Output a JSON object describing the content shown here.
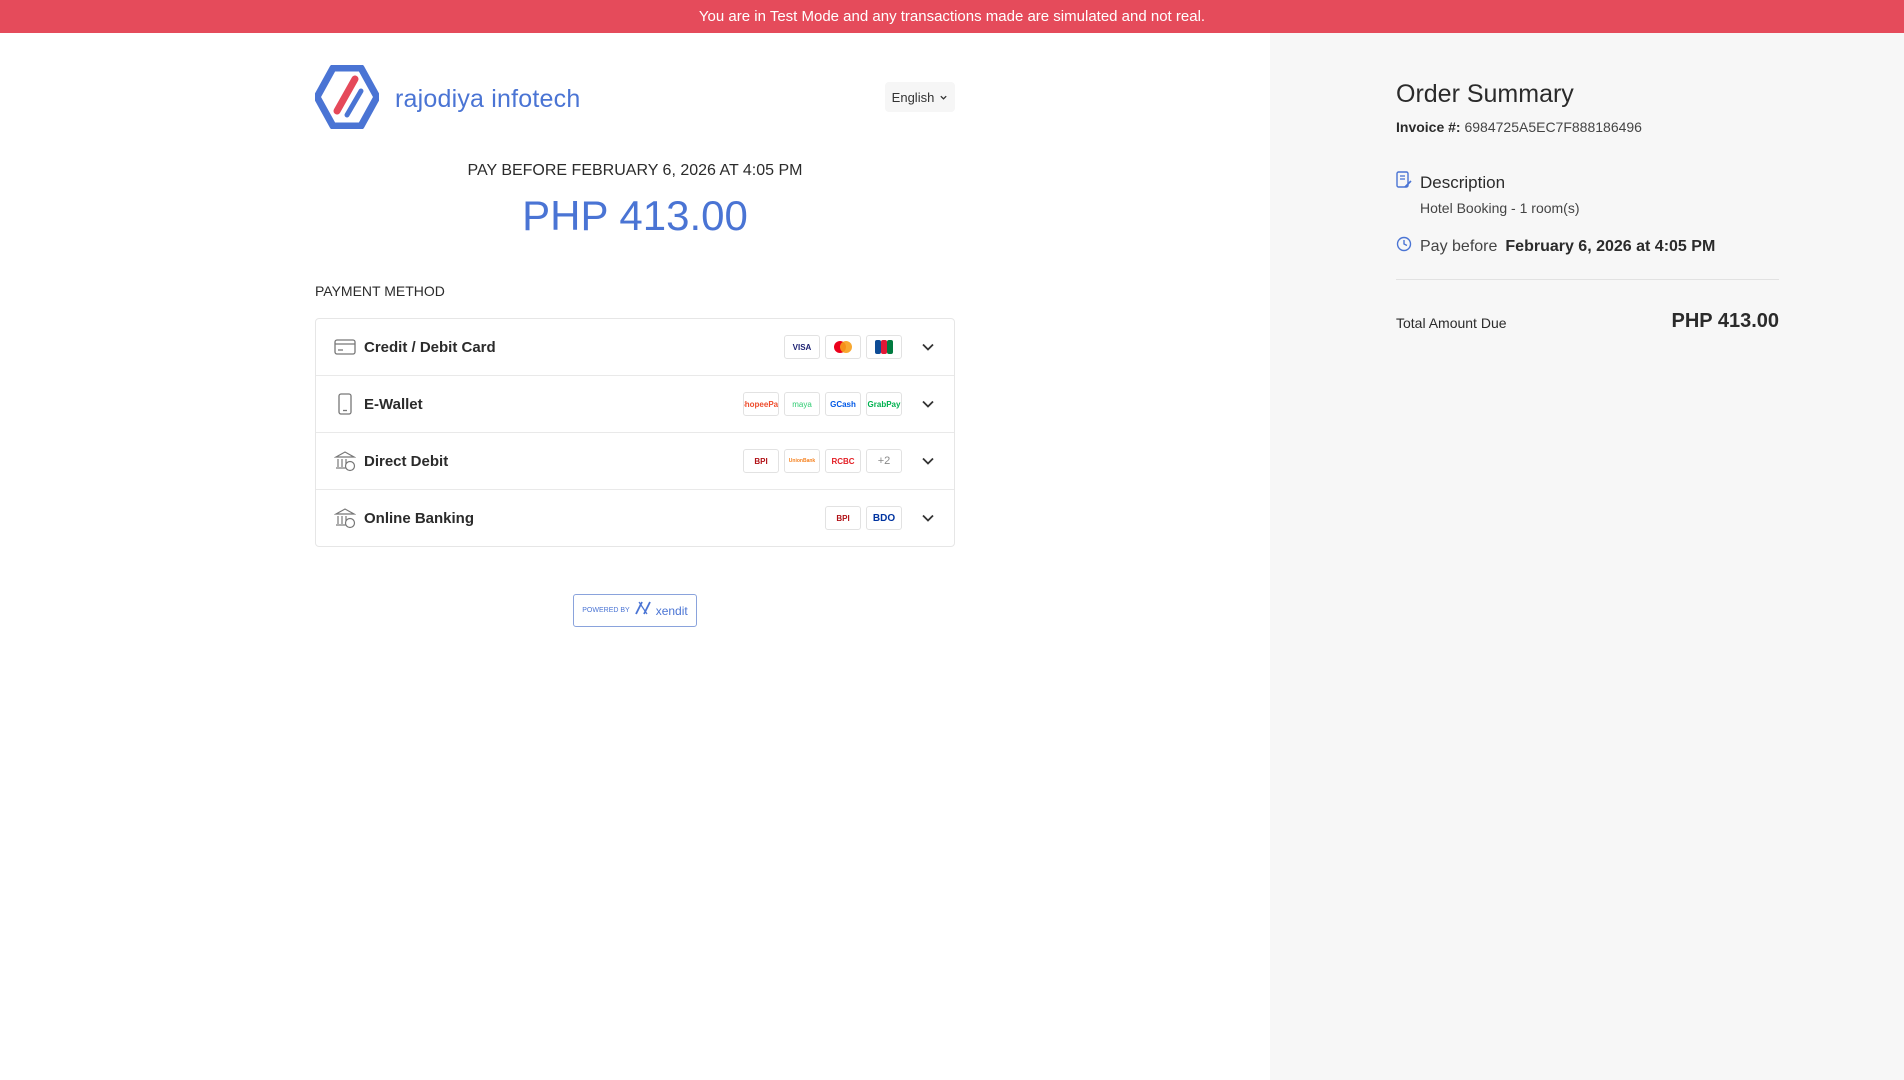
{
  "banner": {
    "text": "You are in Test Mode and any transactions made are simulated and not real."
  },
  "merchant": {
    "name": "rajodiya infotech",
    "logo_icon": "rajodiya-logo-icon"
  },
  "language": {
    "selected": "English"
  },
  "payment": {
    "pay_before": "PAY BEFORE FEBRUARY 6, 2026 AT 4:05 PM",
    "amount": "PHP 413.00",
    "method_title": "PAYMENT METHOD",
    "methods": [
      {
        "label": "Credit / Debit Card",
        "icon": "credit-card-icon",
        "logos": [
          "VISA",
          "mastercard",
          "JCB"
        ]
      },
      {
        "label": "E-Wallet",
        "icon": "mobile-phone-icon",
        "logos": [
          "ShopeePay",
          "maya",
          "GCash",
          "GrabPay"
        ]
      },
      {
        "label": "Direct Debit",
        "icon": "bank-icon",
        "logos": [
          "BPI",
          "UnionBank",
          "RCBC",
          "+2"
        ]
      },
      {
        "label": "Online Banking",
        "icon": "bank-icon",
        "logos": [
          "BPI",
          "BDO"
        ]
      }
    ]
  },
  "powered": {
    "by": "POWERED BY",
    "brand": "xendit"
  },
  "summary": {
    "title": "Order Summary",
    "invoice_label": "Invoice #:",
    "invoice_number": "6984725A5EC7F888186496",
    "description_title": "Description",
    "description_text": "Hotel Booking - 1 room(s)",
    "pay_before_label": "Pay before",
    "pay_before_date": "February 6, 2026 at 4:05 PM",
    "total_label": "Total Amount Due",
    "total_value": "PHP 413.00"
  },
  "colors": {
    "banner": "#e54b5b",
    "accent": "#4a74d4",
    "logo_red": "#e5495a"
  }
}
